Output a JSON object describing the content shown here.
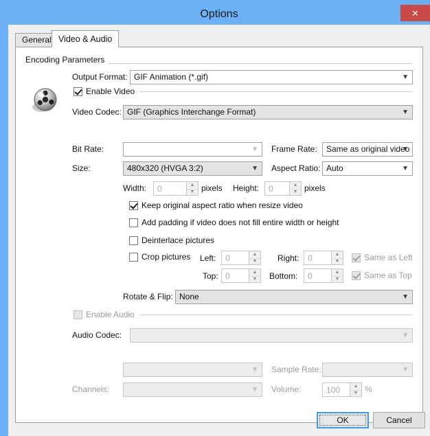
{
  "window": {
    "title": "Options",
    "close_label": "✕",
    "accent_blue": "#6cb0f5",
    "close_red": "#ca4a47"
  },
  "tabs": [
    {
      "label": "General",
      "active": false
    },
    {
      "label": "Video & Audio",
      "active": true
    }
  ],
  "group": {
    "encoding_label": "Encoding Parameters"
  },
  "video": {
    "output_format_label": "Output Format:",
    "output_format_value": "GIF Animation (*.gif)",
    "enable_video_label": "Enable Video",
    "enable_video_checked": true,
    "video_codec_label": "Video Codec:",
    "video_codec_value": "GIF (Graphics Interchange Format)",
    "bit_rate_label": "Bit Rate:",
    "bit_rate_value": "",
    "frame_rate_label": "Frame Rate:",
    "frame_rate_value": "Same as original video",
    "size_label": "Size:",
    "size_value": "480x320    (HVGA 3:2)",
    "aspect_ratio_label": "Aspect Ratio:",
    "aspect_ratio_value": "Auto",
    "width_label": "Width:",
    "width_value": "0",
    "width_units": "pixels",
    "height_label": "Height:",
    "height_value": "0",
    "height_units": "pixels",
    "keep_aspect_label": "Keep original aspect ratio when resize video",
    "keep_aspect_checked": true,
    "add_padding_label": "Add padding if video does not fill entire width or height",
    "add_padding_checked": false,
    "deinterlace_label": "Deinterlace pictures",
    "deinterlace_checked": false,
    "crop_label": "Crop pictures",
    "crop_checked": false,
    "crop_left_label": "Left:",
    "crop_left_value": "0",
    "crop_right_label": "Right:",
    "crop_right_value": "0",
    "same_as_left_label": "Same as Left",
    "same_as_left_checked": true,
    "crop_top_label": "Top:",
    "crop_top_value": "0",
    "crop_bottom_label": "Bottom:",
    "crop_bottom_value": "0",
    "same_as_top_label": "Same as Top",
    "same_as_top_checked": true,
    "rotate_flip_label": "Rotate & Flip:",
    "rotate_flip_value": "None"
  },
  "audio": {
    "enable_audio_label": "Enable Audio",
    "enable_audio_checked": false,
    "audio_codec_label": "Audio Codec:",
    "audio_codec_value": "",
    "audio_bitrate_value": "",
    "sample_rate_label": "Sample Rate:",
    "sample_rate_value": "",
    "channels_label": "Channels:",
    "channels_value": "",
    "volume_label": "Volume:",
    "volume_value": "100",
    "volume_units": "%"
  },
  "footer": {
    "ok_label": "OK",
    "cancel_label": "Cancel"
  },
  "icons": {
    "film_reel": "film-reel-icon",
    "chevron_down": "chevron-down-icon",
    "close": "close-icon"
  }
}
